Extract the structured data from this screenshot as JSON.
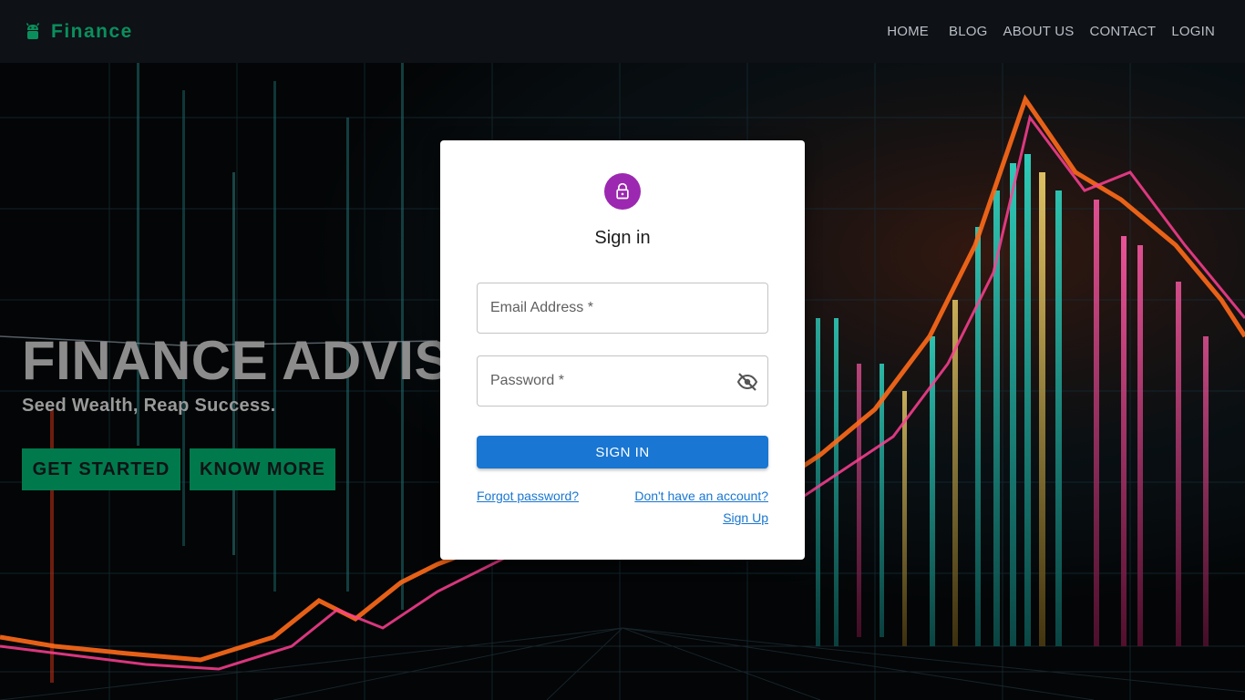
{
  "brand": {
    "name": "Finance",
    "icon": "android-icon"
  },
  "nav": {
    "items": [
      "HOME",
      "BLOG",
      "ABOUT US",
      "CONTACT",
      "LOGIN"
    ]
  },
  "hero": {
    "title": "FINANCE ADVISOR",
    "subtitle": "Seed Wealth, Reap Success.",
    "buttons": {
      "start": "GET STARTED",
      "more": "KNOW MORE"
    },
    "background": "financial-chart-image"
  },
  "signin": {
    "icon": "lock-icon",
    "title": "Sign in",
    "email_label": "Email Address *",
    "password_label": "Password *",
    "password_toggle_icon": "eye-off-icon",
    "submit_label": "SIGN IN",
    "forgot_link": "Forgot password?",
    "no_account_link": "Don't have an account?",
    "signup_link": "Sign Up"
  },
  "colors": {
    "navbar_bg": "#0e1116",
    "brand_green": "#0a8f5c",
    "hero_button_bg": "#007a4d",
    "avatar_purple": "#9c27b0",
    "primary_blue": "#1976d2"
  }
}
